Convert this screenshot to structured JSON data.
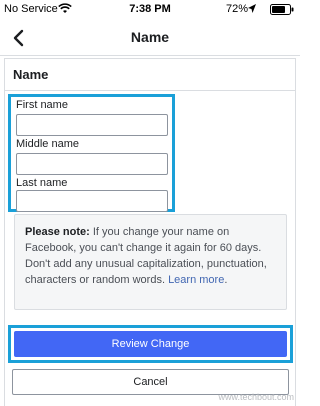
{
  "status_bar": {
    "carrier": "No Service",
    "time": "7:38 PM",
    "battery": "72%"
  },
  "nav": {
    "title": "Name"
  },
  "section": {
    "title": "Name"
  },
  "fields": {
    "first_name_label": "First name",
    "first_name_value": "",
    "middle_name_label": "Middle name",
    "middle_name_value": "",
    "last_name_label": "Last name",
    "last_name_value": ""
  },
  "note": {
    "heading": "Please note:",
    "text": " If you change your name on Facebook, you can't change it again for 60 days. Don't add any unusual capitalization, punctuation, characters or random words. ",
    "learn_more": "Learn more",
    "end": "."
  },
  "buttons": {
    "review": "Review Change",
    "cancel": "Cancel"
  },
  "watermark": "www.techbout.com",
  "colors": {
    "highlight": "#1aa0d8",
    "primary": "#4267f5",
    "link": "#4267b2"
  }
}
